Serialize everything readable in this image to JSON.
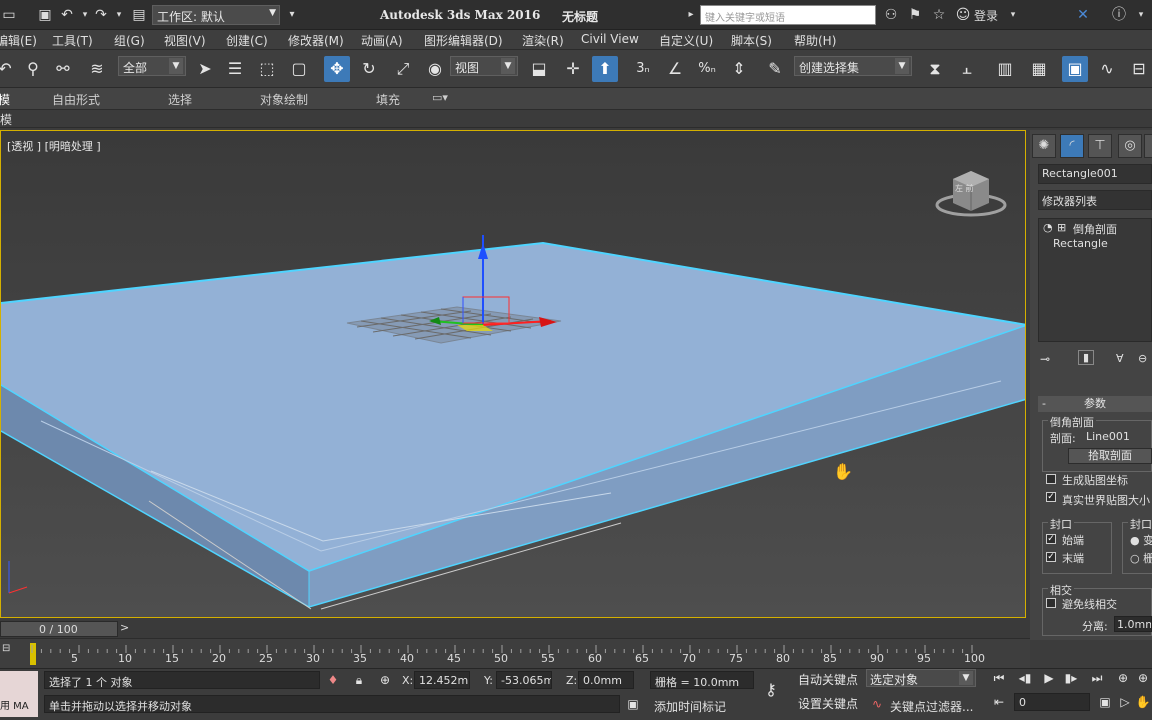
{
  "titlebar": {
    "workspace_label": "工作区: 默认",
    "app_title": "Autodesk 3ds Max 2016",
    "doc_title": "无标题",
    "search_placeholder": "键入关键字或短语",
    "login_label": "登录",
    "help_label": "?"
  },
  "menubar": {
    "items": [
      "编辑(E)",
      "工具(T)",
      "组(G)",
      "视图(V)",
      "创建(C)",
      "修改器(M)",
      "动画(A)",
      "图形编辑器(D)",
      "渲染(R)",
      "Civil View",
      "自定义(U)",
      "脚本(S)",
      "帮助(H)"
    ]
  },
  "toolbar": {
    "selection_filter": "全部",
    "ref_coord": "视图",
    "named_selection": "创建选择集"
  },
  "ribbon": {
    "tabs": [
      "建模",
      "自由形式",
      "选择",
      "对象绘制",
      "填充"
    ],
    "sub_label": "建模"
  },
  "viewport": {
    "label": "[透视 ] [明暗处理 ]",
    "viewcube_label": "左 前"
  },
  "command_panel": {
    "object_name": "Rectangle001",
    "modifier_list": "修改器列表",
    "stack": [
      "倒角剖面",
      "Rectangle"
    ],
    "rollout_title": "参数",
    "group_bevel_profile": "倒角剖面",
    "profile_label": "剖面:",
    "profile_value": "Line001",
    "pick_profile_button": "拾取剖面",
    "gen_map_coords": "生成贴图坐标",
    "real_world_map": "真实世界贴图大小",
    "cap_group": "封口",
    "cap_start": "始端",
    "cap_end": "末端",
    "cap_type_group": "封口",
    "cap_type_morph": "变形",
    "cap_type_grid": "栅格",
    "intersect_group": "相交",
    "avoid_intersect": "避免线相交",
    "separation_label": "分离:",
    "separation_value": "1.0mm"
  },
  "timeline": {
    "frame_counter": "0 / 100",
    "ticks": [
      "5",
      "10",
      "15",
      "20",
      "25",
      "30",
      "35",
      "40",
      "45",
      "50",
      "55",
      "60",
      "65",
      "70",
      "75",
      "80",
      "85",
      "90",
      "95",
      "100"
    ]
  },
  "statusbar": {
    "selection_status": "选择了 1 个 对象",
    "prompt": "单击并拖动以选择并移动对象",
    "x_label": "X:",
    "x_value": "12.452mm",
    "y_label": "Y:",
    "y_value": "-53.065mm",
    "z_label": "Z:",
    "z_value": "0.0mm",
    "grid": "栅格 = 10.0mm",
    "add_time_tag": "添加时间标记",
    "auto_key": "自动关键点",
    "set_key": "设置关键点",
    "key_mode": "选定对象",
    "key_filters": "关键点过滤器...",
    "frame_value": "0",
    "maxscript_label": "用 MA"
  }
}
